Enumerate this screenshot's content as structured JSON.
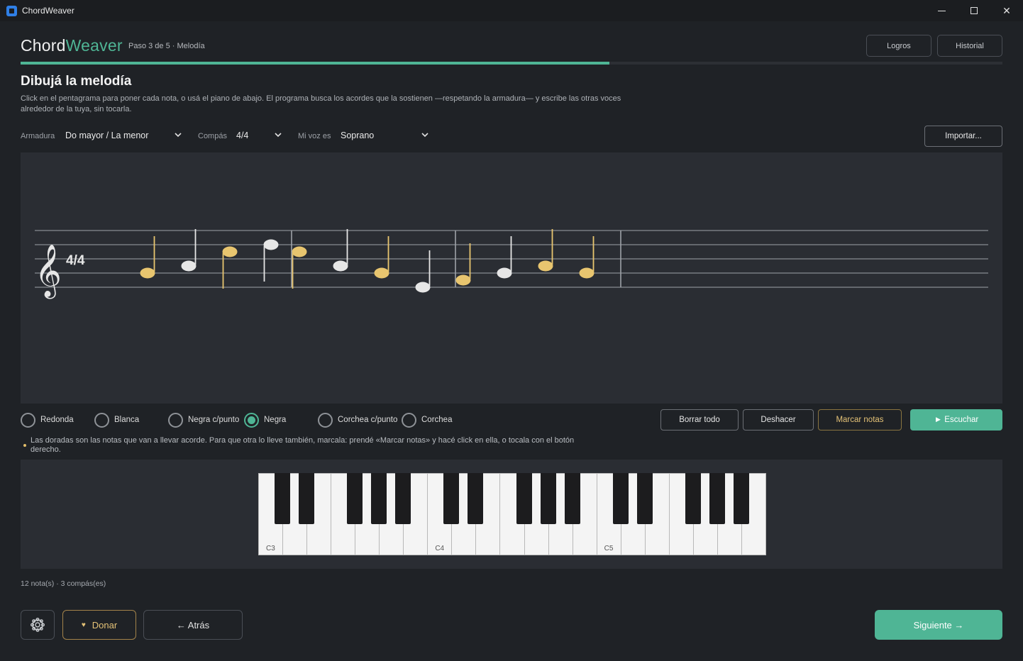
{
  "window": {
    "title": "ChordWeaver",
    "min_icon": "minimize-icon",
    "max_icon": "maximize-icon",
    "close_icon": "close-icon",
    "close_glyph": "✕"
  },
  "header": {
    "brand_part1": "Chord",
    "brand_part2": "Weaver",
    "step": "Paso 3 de 5 · Melodía",
    "progress": 0.6,
    "buttons": [
      "Logros",
      "Historial"
    ]
  },
  "page": {
    "title": "Dibujá la melodía",
    "description": "Click en el pentagrama para poner cada nota, o usá el piano de abajo. El programa busca los acordes que la sostienen —respetando la armadura— y escribe las otras voces alrededor de la tuya, sin tocarla."
  },
  "settings": {
    "key_label": "Armadura",
    "key_value": "Do mayor / La menor",
    "time_label": "Compás",
    "time_value": "4/4",
    "voice_label": "Mi voz es",
    "voice_value": "Soprano",
    "import_label": "Importar..."
  },
  "staff": {
    "clef": "𝄞",
    "time_signature": "4/4",
    "colors": {
      "gold": "#e8c56f",
      "white": "#e6e6e6"
    },
    "measures": [
      [
        {
          "step": 2,
          "color": "gold",
          "stem": "up"
        },
        {
          "step": 3,
          "color": "white",
          "stem": "up"
        },
        {
          "step": 5,
          "color": "gold",
          "stem": "down"
        },
        {
          "step": 6,
          "color": "white",
          "stem": "down"
        }
      ],
      [
        {
          "step": 5,
          "color": "gold",
          "stem": "down"
        },
        {
          "step": 3,
          "color": "white",
          "stem": "up"
        },
        {
          "step": 2,
          "color": "gold",
          "stem": "up"
        },
        {
          "step": 0,
          "color": "white",
          "stem": "up"
        }
      ],
      [
        {
          "step": 1,
          "color": "gold",
          "stem": "up"
        },
        {
          "step": 2,
          "color": "white",
          "stem": "up"
        },
        {
          "step": 3,
          "color": "gold",
          "stem": "up"
        },
        {
          "step": 2,
          "color": "gold",
          "stem": "up"
        }
      ]
    ]
  },
  "durations": {
    "options": [
      "Redonda",
      "Blanca",
      "Negra c/punto",
      "Negra",
      "Corchea c/punto",
      "Corchea"
    ],
    "selected": "Negra"
  },
  "actions": {
    "clear": "Borrar todo",
    "undo": "Deshacer",
    "mark": "Marcar notas",
    "play": "► Escuchar"
  },
  "hint": "Las doradas son las notas que van a llevar acorde. Para que otra lo lleve también, marcala: prendé «Marcar notas» y hacé click en ella, o tocala con el botón derecho.",
  "piano": {
    "labels": {
      "C3": "C3",
      "C4": "C4",
      "C5": "C5"
    },
    "white_keys": 21
  },
  "status": "12 nota(s) · 3 compás(es)",
  "footer": {
    "settings_icon": "gear-icon",
    "donate": "Donar",
    "donate_icon": "heart-icon",
    "back": "← Atrás",
    "next": "Siguiente →"
  }
}
